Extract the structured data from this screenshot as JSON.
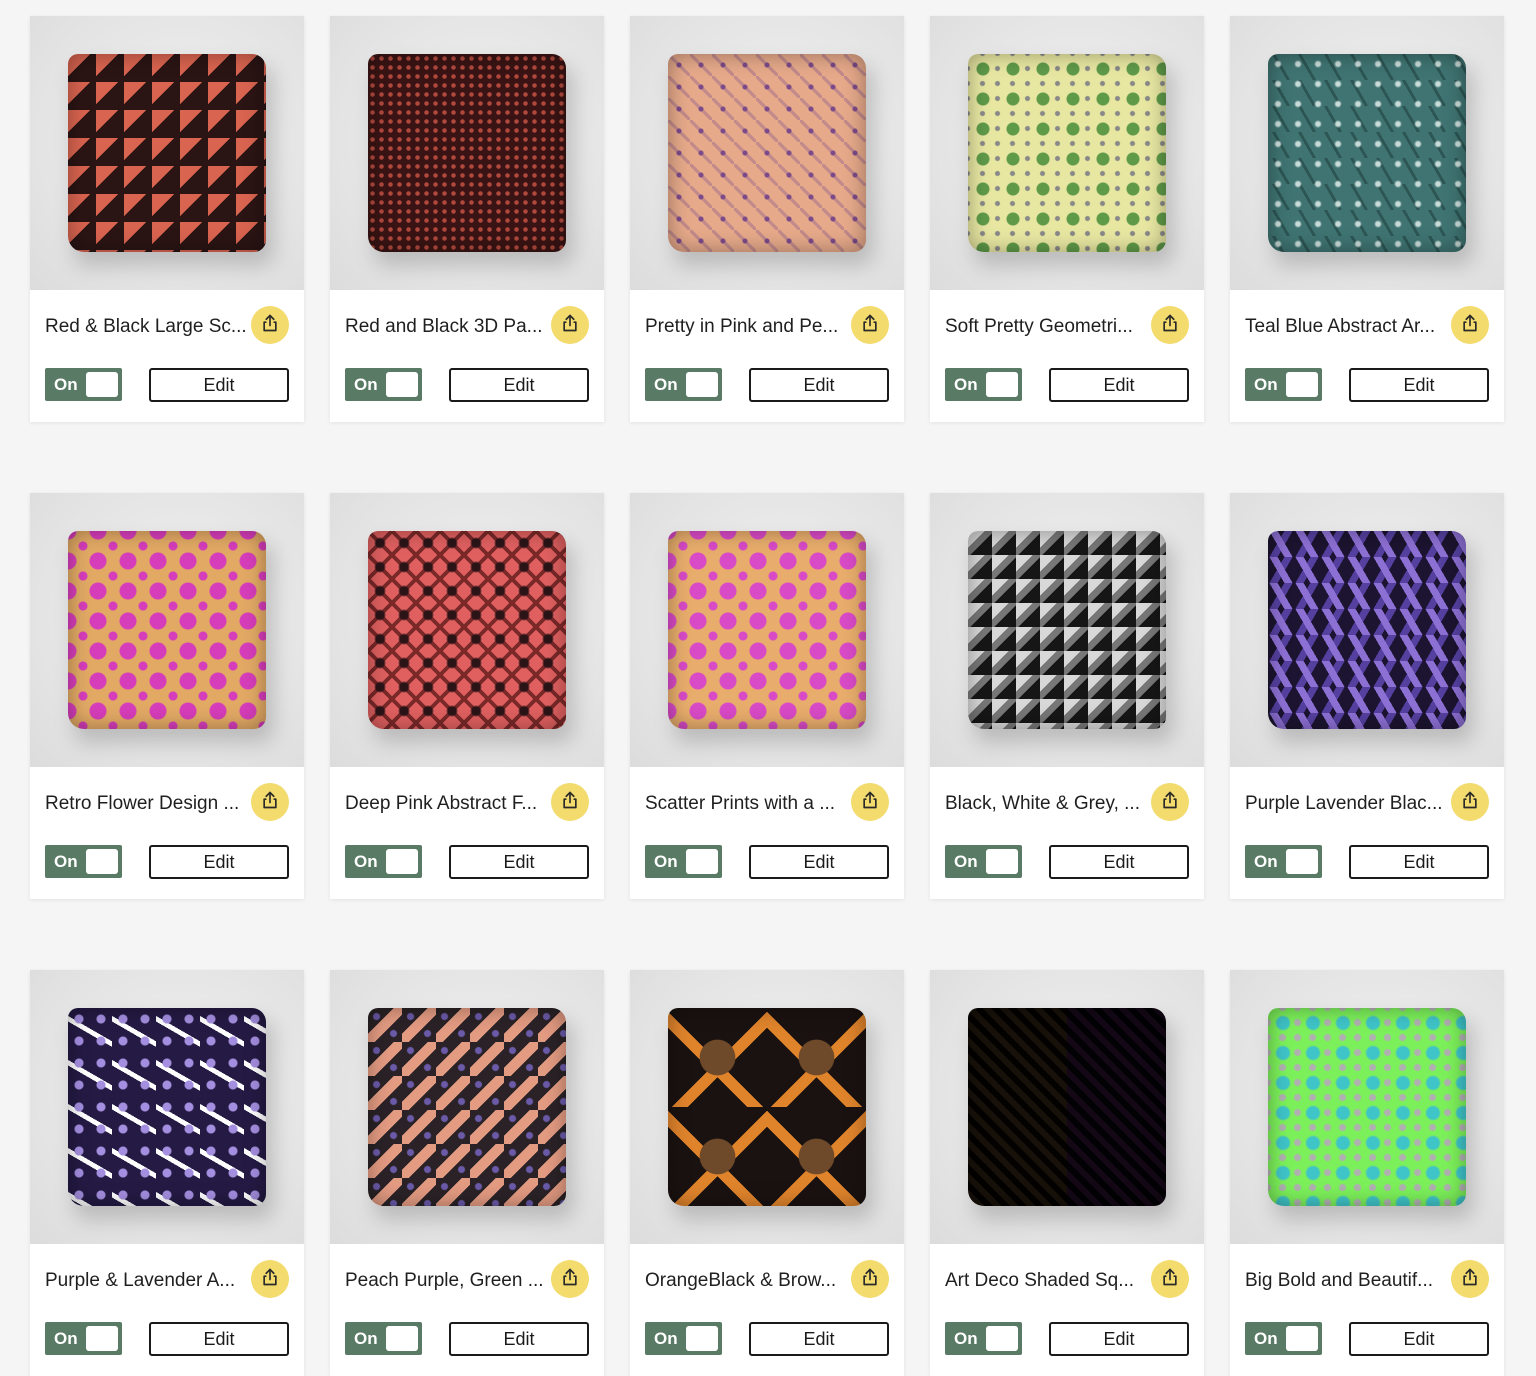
{
  "cards": [
    {
      "title": "Red & Black Large Sc...",
      "toggle": "On",
      "edit": "Edit",
      "pattern": "red-black-squares",
      "colors": [
        "#2b1414",
        "#d96450"
      ]
    },
    {
      "title": "Red and Black 3D Pa...",
      "toggle": "On",
      "edit": "Edit",
      "pattern": "red-black-grid",
      "colors": [
        "#3a1414",
        "#b0483c"
      ]
    },
    {
      "title": "Pretty in Pink and Pe...",
      "toggle": "On",
      "edit": "Edit",
      "pattern": "pink-peach-geometric",
      "colors": [
        "#e6a98a",
        "#7a4a8a"
      ]
    },
    {
      "title": "Soft Pretty Geometri...",
      "toggle": "On",
      "edit": "Edit",
      "pattern": "soft-green-geometric",
      "colors": [
        "#e8e7a2",
        "#5f9a49"
      ]
    },
    {
      "title": "Teal Blue Abstract Ar...",
      "toggle": "On",
      "edit": "Edit",
      "pattern": "teal-abstract",
      "colors": [
        "#3f7472",
        "#c7dbd8"
      ]
    },
    {
      "title": "Retro Flower Design ...",
      "toggle": "On",
      "edit": "Edit",
      "pattern": "retro-flowers",
      "colors": [
        "#e2a965",
        "#d63dba"
      ]
    },
    {
      "title": "Deep Pink Abstract F...",
      "toggle": "On",
      "edit": "Edit",
      "pattern": "deep-pink-abstract",
      "colors": [
        "#e06060",
        "#2a1418"
      ]
    },
    {
      "title": "Scatter Prints with a ...",
      "toggle": "On",
      "edit": "Edit",
      "pattern": "scatter-flowers",
      "colors": [
        "#e8ad6c",
        "#d84ac6"
      ]
    },
    {
      "title": "Black, White & Grey, ...",
      "toggle": "On",
      "edit": "Edit",
      "pattern": "black-white-squares",
      "colors": [
        "#161616",
        "#d8d8d8"
      ]
    },
    {
      "title": "Purple Lavender Blac...",
      "toggle": "On",
      "edit": "Edit",
      "pattern": "purple-lavender-black",
      "colors": [
        "#1c1430",
        "#8d70d4"
      ]
    },
    {
      "title": "Purple & Lavender A...",
      "toggle": "On",
      "edit": "Edit",
      "pattern": "purple-lavender-arrows",
      "colors": [
        "#241a44",
        "#a48ee0"
      ]
    },
    {
      "title": "Peach Purple, Green ...",
      "toggle": "On",
      "edit": "Edit",
      "pattern": "peach-purple-green",
      "colors": [
        "#2a2226",
        "#e39b82"
      ]
    },
    {
      "title": "OrangeBlack & Brow...",
      "toggle": "On",
      "edit": "Edit",
      "pattern": "orange-black-brown",
      "colors": [
        "#1a1210",
        "#e0842c"
      ]
    },
    {
      "title": "Art Deco Shaded Sq...",
      "toggle": "On",
      "edit": "Edit",
      "pattern": "art-deco-squares",
      "colors": [
        "#1a1a1a",
        "#e3a35a",
        "#c84ad6"
      ]
    },
    {
      "title": "Big Bold and Beautif...",
      "toggle": "On",
      "edit": "Edit",
      "pattern": "big-bold-green",
      "colors": [
        "#7cf05a",
        "#3fc4c8"
      ]
    }
  ],
  "share_icon": "share-icon",
  "colors": {
    "toggle_on": "#597a64",
    "share_bg": "#f3db6d",
    "page_bg": "#f5f5f5"
  }
}
